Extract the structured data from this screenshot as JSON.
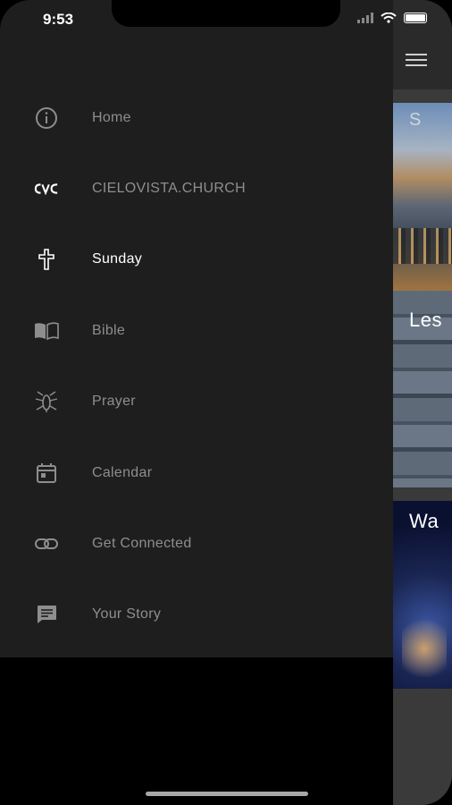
{
  "status_bar": {
    "time": "9:53"
  },
  "drawer": {
    "items": [
      {
        "label": "Home",
        "icon": "info-icon",
        "active": false
      },
      {
        "label": "CIELOVISTA.CHURCH",
        "icon": "cvc-logo-icon",
        "active": false
      },
      {
        "label": "Sunday",
        "icon": "cross-icon",
        "active": true
      },
      {
        "label": "Bible",
        "icon": "book-icon",
        "active": false
      },
      {
        "label": "Prayer",
        "icon": "prayer-icon",
        "active": false
      },
      {
        "label": "Calendar",
        "icon": "calendar-icon",
        "active": false
      },
      {
        "label": "Get Connected",
        "icon": "link-icon",
        "active": false
      },
      {
        "label": "Your Story",
        "icon": "chat-icon",
        "active": false
      }
    ]
  },
  "content_peek": {
    "cards": [
      {
        "title": "S"
      },
      {
        "title": "Les"
      },
      {
        "title": "Wa"
      }
    ]
  },
  "colors": {
    "drawer_bg": "#1e1e1e",
    "active_label": "#ffffff",
    "inactive_label": "#8e8e8e"
  }
}
